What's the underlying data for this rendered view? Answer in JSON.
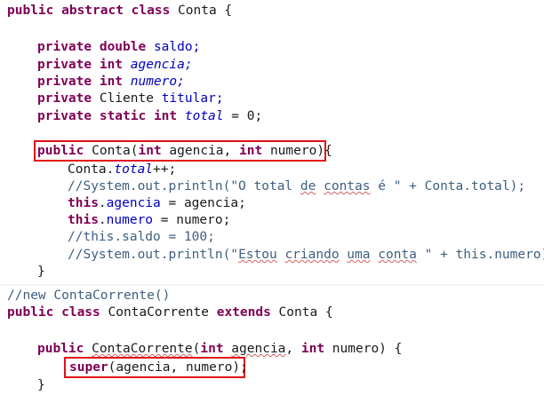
{
  "block1": {
    "class_decl": {
      "k1": "public abstract class",
      "name": " Conta {"
    },
    "fields": [
      {
        "k": "private double",
        "n": " saldo;"
      },
      {
        "k": "private int",
        "n": " agencia;"
      },
      {
        "k": "private int",
        "n": " numero;"
      },
      {
        "k": "private",
        "t": " Cliente ",
        "n": "titular;"
      },
      {
        "k": "private static int",
        "n": " total",
        "rest": " = 0;"
      }
    ],
    "ctor": {
      "k1": "public",
      "t1": " Conta(",
      "k2": "int",
      "t2": " agencia, ",
      "k3": "int",
      "t3": " numero){"
    },
    "body": {
      "l1a": "Conta.",
      "l1b": "total",
      "l1c": "++;",
      "l2a": "//System.out.println(\"O total ",
      "l2b": "de",
      "l2c": " ",
      "l2d": "contas",
      "l2e": " é \" + Conta.total);",
      "l3a": "this",
      "l3b": ".",
      "l3c": "agencia",
      "l3d": " = agencia;",
      "l4a": "this",
      "l4b": ".",
      "l4c": "numero",
      "l4d": " = numero;",
      "l5": "//this.saldo = 100;",
      "l6a": "//System.out.println(\"",
      "l6b": "Estou",
      "l6c": " ",
      "l6d": "criando",
      "l6e": " ",
      "l6f": "uma",
      "l6g": " ",
      "l6h": "conta",
      "l6i": " \" + this.numero);"
    },
    "close": "}"
  },
  "block2": {
    "comment": "//new ContaCorrente()",
    "class_decl": {
      "k1": "public class",
      "t1": " ContaCorrente ",
      "k2": "extends",
      "t2": " Conta {"
    },
    "ctor": {
      "k1": "public",
      "t1": " ",
      "t1b": "ContaCorrente",
      "t1c": "(",
      "k2": "int",
      "t2": " ",
      "t2b": "agencia",
      "t2c": ", ",
      "k3": "int",
      "t3": " numero) {"
    },
    "super": {
      "k": "super",
      "t": "(agencia, numero);"
    },
    "close": "}"
  }
}
